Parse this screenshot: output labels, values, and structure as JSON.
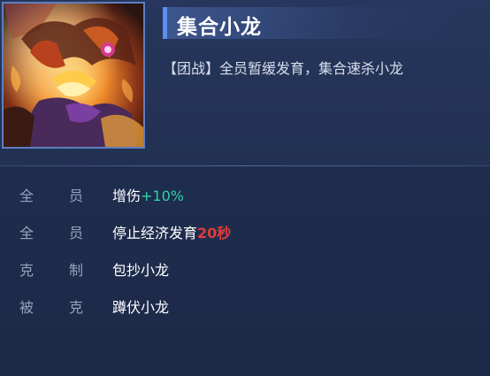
{
  "header": {
    "title": "集合小龙",
    "description": "【团战】全员暂缓发育，集合速杀小龙"
  },
  "thumbnail": {
    "icon": "dragon-art-icon"
  },
  "stats": {
    "rows": [
      {
        "label_a": "全",
        "label_b": "员",
        "value": "增伤",
        "highlight": "+10%"
      },
      {
        "label_a": "全",
        "label_b": "员",
        "value": "停止经济发育",
        "highlight": "20秒"
      },
      {
        "label_a": "克",
        "label_b": "制",
        "value": "包抄小龙",
        "highlight": ""
      },
      {
        "label_a": "被",
        "label_b": "克",
        "value": "蹲伏小龙",
        "highlight": ""
      }
    ]
  },
  "colors": {
    "accent": "#5d8ef0",
    "positive": "#2fd3a3",
    "negative": "#e23a3a",
    "label": "#95a3bd"
  }
}
